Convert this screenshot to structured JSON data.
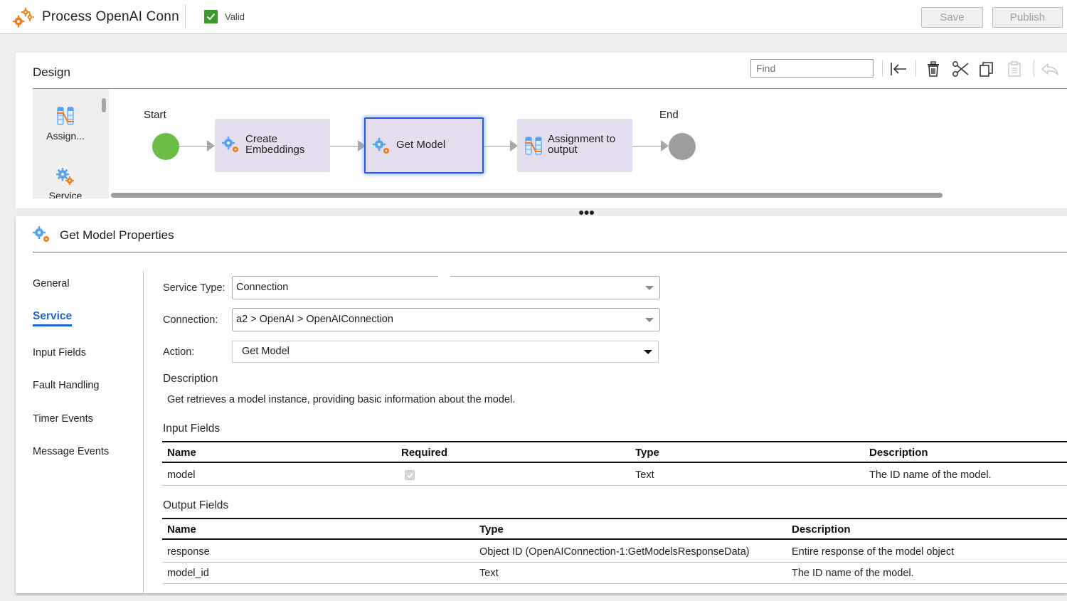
{
  "header": {
    "app_title": "Process OpenAI Conn",
    "status_label": "Valid",
    "save_label": "Save",
    "publish_label": "Publish",
    "colors": {
      "valid": "#3a9a2b",
      "accent": "#1a67d2"
    }
  },
  "design": {
    "title": "Design",
    "find_placeholder": "Find",
    "toolbar_icons": [
      "collapse-left-icon",
      "trash-icon",
      "scissors-icon",
      "copy-icon",
      "paste-icon",
      "undo-icon"
    ],
    "palette": [
      {
        "label": "Assign...",
        "icon": "assignment-icon"
      },
      {
        "label": "Service",
        "icon": "service-gears-icon"
      }
    ],
    "flow": {
      "start_label": "Start",
      "end_label": "End",
      "steps": [
        {
          "label_line1": "Create",
          "label_line2": "Embeddings",
          "icon": "service-gears-icon",
          "selected": false
        },
        {
          "label_line1": "Get Model",
          "label_line2": "",
          "icon": "service-gears-icon",
          "selected": true
        },
        {
          "label_line1": "Assignment to",
          "label_line2": "output",
          "icon": "assignment-icon",
          "selected": false
        }
      ]
    }
  },
  "properties": {
    "title": "Get Model Properties",
    "nav": [
      {
        "label": "General",
        "active": false
      },
      {
        "label": "Service",
        "active": true
      },
      {
        "label": "Input Fields",
        "active": false
      },
      {
        "label": "Fault Handling",
        "active": false
      },
      {
        "label": "Timer Events",
        "active": false
      },
      {
        "label": "Message Events",
        "active": false
      }
    ],
    "service_type": {
      "label": "Service Type:",
      "value": "Connection"
    },
    "connection": {
      "label": "Connection:",
      "value": "a2 > OpenAI > OpenAIConnection"
    },
    "action": {
      "label": "Action:",
      "value": "Get Model"
    },
    "description": {
      "title": "Description",
      "text": "Get retrieves a model instance, providing basic information about the model."
    },
    "input_fields": {
      "title": "Input Fields",
      "columns": [
        "Name",
        "Required",
        "Type",
        "Description"
      ],
      "rows": [
        {
          "name": "model",
          "required": true,
          "type": "Text",
          "description": "The ID name of the model."
        }
      ]
    },
    "output_fields": {
      "title": "Output Fields",
      "columns": [
        "Name",
        "Type",
        "Description"
      ],
      "rows": [
        {
          "name": "response",
          "type": "Object ID (OpenAIConnection-1:GetModelsResponseData)",
          "description": "Entire response of the model object"
        },
        {
          "name": "model_id",
          "type": "Text",
          "description": "The ID name of the model."
        }
      ]
    }
  }
}
